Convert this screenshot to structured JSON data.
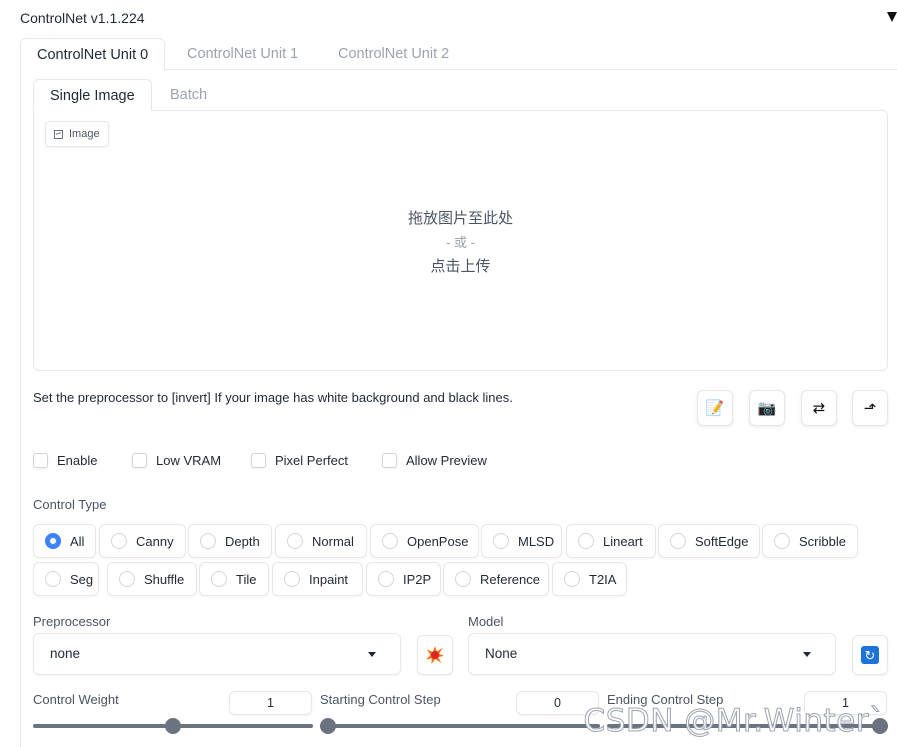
{
  "accordion": {
    "title": "ControlNet v1.1.224",
    "toggle_icon": "triangle-down-icon"
  },
  "unit_tabs": [
    {
      "label": "ControlNet Unit 0",
      "active": true
    },
    {
      "label": "ControlNet Unit 1",
      "active": false
    },
    {
      "label": "ControlNet Unit 2",
      "active": false
    }
  ],
  "mode_tabs": [
    {
      "label": "Single Image",
      "active": true
    },
    {
      "label": "Batch",
      "active": false
    }
  ],
  "image_input": {
    "label": "Image",
    "drop_text": "拖放图片至此处",
    "or_text": "- 或 -",
    "upload_text": "点击上传"
  },
  "hint": "Set the preprocessor to [invert] If your image has white background and black lines.",
  "tool_buttons": [
    {
      "icon": "memo-icon",
      "glyph": "📝"
    },
    {
      "icon": "camera-icon",
      "glyph": "📷"
    },
    {
      "icon": "swap-icon",
      "glyph": "⇄"
    },
    {
      "icon": "send-dimensions-icon",
      "glyph": "⬏"
    }
  ],
  "checkboxes": [
    {
      "label": "Enable",
      "checked": false
    },
    {
      "label": "Low VRAM",
      "checked": false
    },
    {
      "label": "Pixel Perfect",
      "checked": false
    },
    {
      "label": "Allow Preview",
      "checked": false
    }
  ],
  "control_type": {
    "label": "Control Type",
    "selected": "All",
    "row1": [
      "All",
      "Canny",
      "Depth",
      "Normal",
      "OpenPose",
      "MLSD",
      "Lineart",
      "SoftEdge",
      "Scribble"
    ],
    "row2": [
      "Seg",
      "Shuffle",
      "Tile",
      "Inpaint",
      "IP2P",
      "Reference",
      "T2IA"
    ]
  },
  "preprocessor": {
    "label": "Preprocessor",
    "value": "none",
    "run_icon": "explosion-icon"
  },
  "model": {
    "label": "Model",
    "value": "None",
    "refresh_icon": "refresh-icon"
  },
  "control_weight": {
    "label": "Control Weight",
    "value": "1",
    "fraction": 0.5
  },
  "starting_step": {
    "label": "Starting Control Step",
    "value": "0",
    "fraction": 0.0
  },
  "ending_step": {
    "label": "Ending Control Step",
    "value": "1",
    "fraction": 1.0
  },
  "watermark": "CSDN @Mr.Winter`",
  "colors": {
    "accent": "#3b82f6",
    "border": "#e5e7eb",
    "muted": "#9ca3af",
    "slider": "#6b7280"
  }
}
